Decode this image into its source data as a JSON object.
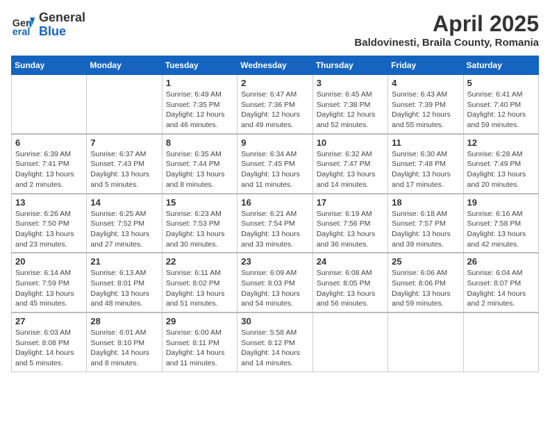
{
  "header": {
    "logo": {
      "line1": "General",
      "line2": "Blue"
    },
    "title": "April 2025",
    "location": "Baldovinesti, Braila County, Romania"
  },
  "weekdays": [
    "Sunday",
    "Monday",
    "Tuesday",
    "Wednesday",
    "Thursday",
    "Friday",
    "Saturday"
  ],
  "weeks": [
    [
      {
        "day": "",
        "info": ""
      },
      {
        "day": "",
        "info": ""
      },
      {
        "day": "1",
        "info": "Sunrise: 6:49 AM\nSunset: 7:35 PM\nDaylight: 12 hours and 46 minutes."
      },
      {
        "day": "2",
        "info": "Sunrise: 6:47 AM\nSunset: 7:36 PM\nDaylight: 12 hours and 49 minutes."
      },
      {
        "day": "3",
        "info": "Sunrise: 6:45 AM\nSunset: 7:38 PM\nDaylight: 12 hours and 52 minutes."
      },
      {
        "day": "4",
        "info": "Sunrise: 6:43 AM\nSunset: 7:39 PM\nDaylight: 12 hours and 55 minutes."
      },
      {
        "day": "5",
        "info": "Sunrise: 6:41 AM\nSunset: 7:40 PM\nDaylight: 12 hours and 59 minutes."
      }
    ],
    [
      {
        "day": "6",
        "info": "Sunrise: 6:39 AM\nSunset: 7:41 PM\nDaylight: 13 hours and 2 minutes."
      },
      {
        "day": "7",
        "info": "Sunrise: 6:37 AM\nSunset: 7:43 PM\nDaylight: 13 hours and 5 minutes."
      },
      {
        "day": "8",
        "info": "Sunrise: 6:35 AM\nSunset: 7:44 PM\nDaylight: 13 hours and 8 minutes."
      },
      {
        "day": "9",
        "info": "Sunrise: 6:34 AM\nSunset: 7:45 PM\nDaylight: 13 hours and 11 minutes."
      },
      {
        "day": "10",
        "info": "Sunrise: 6:32 AM\nSunset: 7:47 PM\nDaylight: 13 hours and 14 minutes."
      },
      {
        "day": "11",
        "info": "Sunrise: 6:30 AM\nSunset: 7:48 PM\nDaylight: 13 hours and 17 minutes."
      },
      {
        "day": "12",
        "info": "Sunrise: 6:28 AM\nSunset: 7:49 PM\nDaylight: 13 hours and 20 minutes."
      }
    ],
    [
      {
        "day": "13",
        "info": "Sunrise: 6:26 AM\nSunset: 7:50 PM\nDaylight: 13 hours and 23 minutes."
      },
      {
        "day": "14",
        "info": "Sunrise: 6:25 AM\nSunset: 7:52 PM\nDaylight: 13 hours and 27 minutes."
      },
      {
        "day": "15",
        "info": "Sunrise: 6:23 AM\nSunset: 7:53 PM\nDaylight: 13 hours and 30 minutes."
      },
      {
        "day": "16",
        "info": "Sunrise: 6:21 AM\nSunset: 7:54 PM\nDaylight: 13 hours and 33 minutes."
      },
      {
        "day": "17",
        "info": "Sunrise: 6:19 AM\nSunset: 7:56 PM\nDaylight: 13 hours and 36 minutes."
      },
      {
        "day": "18",
        "info": "Sunrise: 6:18 AM\nSunset: 7:57 PM\nDaylight: 13 hours and 39 minutes."
      },
      {
        "day": "19",
        "info": "Sunrise: 6:16 AM\nSunset: 7:58 PM\nDaylight: 13 hours and 42 minutes."
      }
    ],
    [
      {
        "day": "20",
        "info": "Sunrise: 6:14 AM\nSunset: 7:59 PM\nDaylight: 13 hours and 45 minutes."
      },
      {
        "day": "21",
        "info": "Sunrise: 6:13 AM\nSunset: 8:01 PM\nDaylight: 13 hours and 48 minutes."
      },
      {
        "day": "22",
        "info": "Sunrise: 6:11 AM\nSunset: 8:02 PM\nDaylight: 13 hours and 51 minutes."
      },
      {
        "day": "23",
        "info": "Sunrise: 6:09 AM\nSunset: 8:03 PM\nDaylight: 13 hours and 54 minutes."
      },
      {
        "day": "24",
        "info": "Sunrise: 6:08 AM\nSunset: 8:05 PM\nDaylight: 13 hours and 56 minutes."
      },
      {
        "day": "25",
        "info": "Sunrise: 6:06 AM\nSunset: 8:06 PM\nDaylight: 13 hours and 59 minutes."
      },
      {
        "day": "26",
        "info": "Sunrise: 6:04 AM\nSunset: 8:07 PM\nDaylight: 14 hours and 2 minutes."
      }
    ],
    [
      {
        "day": "27",
        "info": "Sunrise: 6:03 AM\nSunset: 8:08 PM\nDaylight: 14 hours and 5 minutes."
      },
      {
        "day": "28",
        "info": "Sunrise: 6:01 AM\nSunset: 8:10 PM\nDaylight: 14 hours and 8 minutes."
      },
      {
        "day": "29",
        "info": "Sunrise: 6:00 AM\nSunset: 8:11 PM\nDaylight: 14 hours and 11 minutes."
      },
      {
        "day": "30",
        "info": "Sunrise: 5:58 AM\nSunset: 8:12 PM\nDaylight: 14 hours and 14 minutes."
      },
      {
        "day": "",
        "info": ""
      },
      {
        "day": "",
        "info": ""
      },
      {
        "day": "",
        "info": ""
      }
    ]
  ]
}
